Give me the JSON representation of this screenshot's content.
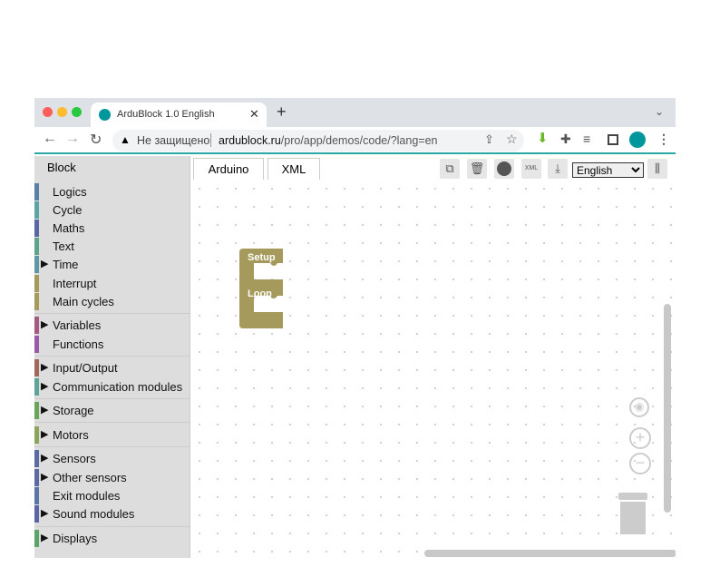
{
  "browser": {
    "tab_title": "ArduBlock 1.0 English",
    "new_tab": "+",
    "security": "Не защищено",
    "url_host": "ardublock.ru",
    "url_path": "/pro/app/demos/code/?lang=en"
  },
  "sidebar": {
    "title": "Block",
    "items": [
      {
        "label": "Logics",
        "color": "#5b80a5",
        "expandable": false
      },
      {
        "label": "Cycle",
        "color": "#5ba5a5",
        "expandable": false
      },
      {
        "label": "Maths",
        "color": "#5b67a5",
        "expandable": false
      },
      {
        "label": "Text",
        "color": "#5ba58c",
        "expandable": false
      },
      {
        "label": "Time",
        "color": "#5b9aa5",
        "expandable": true
      },
      {
        "label": "Interrupt",
        "color": "#a59b5b",
        "expandable": false
      },
      {
        "label": "Main cycles",
        "color": "#a59b5b",
        "expandable": false
      },
      {
        "label": "Variables",
        "color": "#a55b80",
        "expandable": true
      },
      {
        "label": "Functions",
        "color": "#995ba5",
        "expandable": false
      },
      {
        "label": "Input/Output",
        "color": "#a5675b",
        "expandable": true
      },
      {
        "label": "Communication modules",
        "color": "#5ba59a",
        "expandable": true
      },
      {
        "label": "Storage",
        "color": "#6ba55b",
        "expandable": true
      },
      {
        "label": "Motors",
        "color": "#8ca55b",
        "expandable": true
      },
      {
        "label": "Sensors",
        "color": "#5b6ba5",
        "expandable": true
      },
      {
        "label": "Other sensors",
        "color": "#5b6ba5",
        "expandable": true
      },
      {
        "label": "Exit modules",
        "color": "#5b75a5",
        "expandable": false
      },
      {
        "label": "Sound modules",
        "color": "#5b67a5",
        "expandable": true
      },
      {
        "label": "Displays",
        "color": "#5ba56b",
        "expandable": true
      }
    ]
  },
  "tabs": [
    "Arduino",
    "XML"
  ],
  "toolbar": {
    "language": "English",
    "buttons": [
      "copy-icon",
      "trash-icon",
      "arduino-icon",
      "xml-file-icon",
      "download-icon",
      "library-icon"
    ],
    "xml_label": "XML"
  },
  "workspace": {
    "block": {
      "setup": "Setup",
      "loop": "Loop",
      "color": "#a59a5b"
    }
  },
  "arrow": "▶"
}
